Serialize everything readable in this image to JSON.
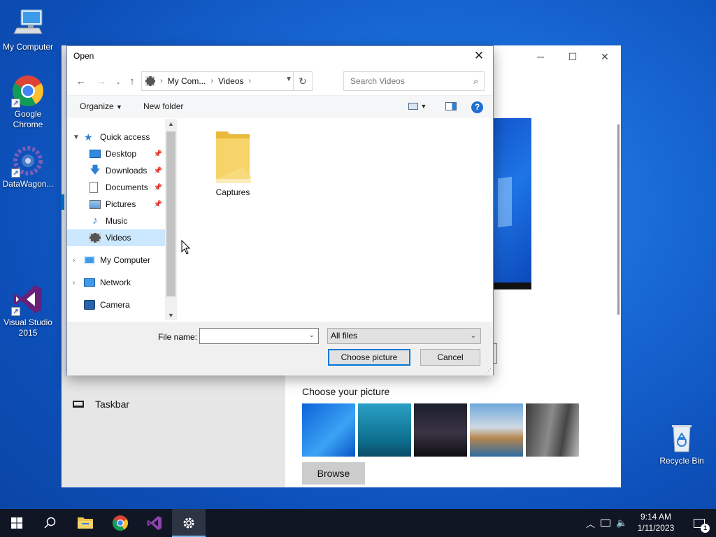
{
  "desktop": {
    "icons": [
      {
        "label": "My Computer"
      },
      {
        "label": "Google Chrome"
      },
      {
        "label": "DataWagon..."
      },
      {
        "label": "Visual Studio 2015"
      },
      {
        "label": "Recycle Bin"
      }
    ]
  },
  "settings_window": {
    "taskbar_item": "Taskbar",
    "choose_picture_title": "Choose your picture",
    "browse_label": "Browse",
    "thumbnails": [
      "windows-hero",
      "underwater-swimmer",
      "night-sky-tent",
      "beach-rocks-sunset",
      "rock-cliff"
    ]
  },
  "dialog": {
    "title": "Open",
    "address": {
      "root": "My Com...",
      "current": "Videos"
    },
    "search_placeholder": "Search Videos",
    "toolbar": {
      "organize": "Organize",
      "new_folder": "New folder"
    },
    "nav": {
      "quick_access": "Quick access",
      "items": [
        "Desktop",
        "Downloads",
        "Documents",
        "Pictures",
        "Music",
        "Videos"
      ],
      "selected": "Videos",
      "my_computer": "My Computer",
      "network": "Network",
      "camera": "Camera"
    },
    "content": {
      "folders": [
        "Captures"
      ]
    },
    "file_name_label": "File name:",
    "file_name_value": "",
    "file_type": "All files",
    "choose_button": "Choose picture",
    "cancel_button": "Cancel"
  },
  "taskbar": {
    "time": "9:14 AM",
    "date": "1/11/2023",
    "notification_count": "1"
  },
  "colors": {
    "accent": "#0078d7",
    "selection": "#cce8ff",
    "taskbar": "#101624"
  }
}
